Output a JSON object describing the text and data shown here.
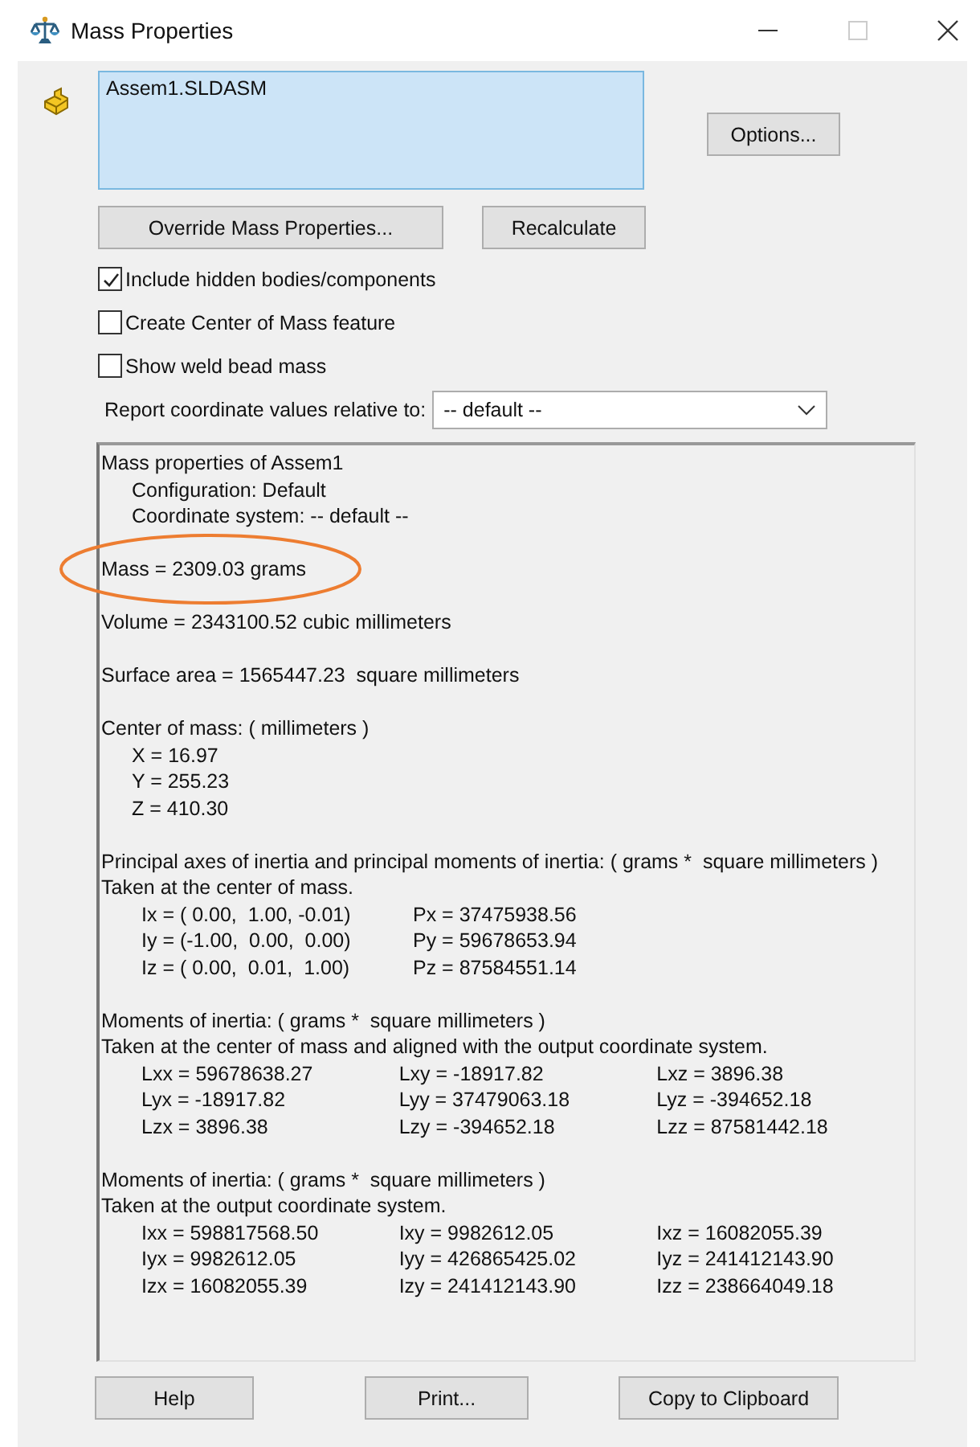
{
  "window": {
    "title": "Mass Properties"
  },
  "selection_list": {
    "items": [
      "Assem1.SLDASM"
    ]
  },
  "buttons_top": [
    {
      "label": "Options..."
    }
  ],
  "buttons_mid": [
    {
      "label": "Override Mass Properties..."
    },
    {
      "label": "Recalculate"
    }
  ],
  "checkboxes": [
    {
      "label": "Include hidden bodies/components",
      "checked": true
    },
    {
      "label": "Create Center of Mass feature",
      "checked": false
    },
    {
      "label": "Show weld bead mass",
      "checked": false
    }
  ],
  "coordinate_select": {
    "label": "Report coordinate values relative to:",
    "value": "-- default --"
  },
  "report": {
    "lines": [
      {
        "kind": "text",
        "text": "Mass properties of Assem1"
      },
      {
        "kind": "indent",
        "text": "Configuration: Default"
      },
      {
        "kind": "indent",
        "text": "Coordinate system: -- default --"
      },
      {
        "kind": "gap"
      },
      {
        "kind": "text",
        "text": "Mass = 2309.03 grams",
        "highlighted": true
      },
      {
        "kind": "gap"
      },
      {
        "kind": "text",
        "text": "Volume = 2343100.52 cubic millimeters"
      },
      {
        "kind": "gap"
      },
      {
        "kind": "text",
        "text": "Surface area = 1565447.23  square millimeters"
      },
      {
        "kind": "gap"
      },
      {
        "kind": "text",
        "text": "Center of mass: ( millimeters )"
      },
      {
        "kind": "indent",
        "text": "X = 16.97"
      },
      {
        "kind": "indent",
        "text": "Y = 255.23"
      },
      {
        "kind": "indent",
        "text": "Z = 410.30"
      },
      {
        "kind": "gap"
      },
      {
        "kind": "text",
        "text": "Principal axes of inertia and principal moments of inertia: ( grams *  square millimeters )"
      },
      {
        "kind": "text",
        "text": "Taken at the center of mass."
      },
      {
        "kind": "row",
        "cells": [
          "Ix = ( 0.00,  1.00, -0.01)",
          "Px = 37475938.56"
        ]
      },
      {
        "kind": "row",
        "cells": [
          "Iy = (-1.00,  0.00,  0.00)",
          "Py = 59678653.94"
        ]
      },
      {
        "kind": "row",
        "cells": [
          "Iz = ( 0.00,  0.01,  1.00)",
          "Pz = 87584551.14"
        ]
      },
      {
        "kind": "gap"
      },
      {
        "kind": "text",
        "text": "Moments of inertia: ( grams *  square millimeters )"
      },
      {
        "kind": "text",
        "text": "Taken at the center of mass and aligned with the output coordinate system."
      },
      {
        "kind": "row",
        "cells": [
          "Lxx = 59678638.27",
          "Lxy = -18917.82",
          "Lxz = 3896.38"
        ]
      },
      {
        "kind": "row",
        "cells": [
          "Lyx = -18917.82",
          "Lyy = 37479063.18",
          "Lyz = -394652.18"
        ]
      },
      {
        "kind": "row",
        "cells": [
          "Lzx = 3896.38",
          "Lzy = -394652.18",
          "Lzz = 87581442.18"
        ]
      },
      {
        "kind": "gap"
      },
      {
        "kind": "text",
        "text": "Moments of inertia: ( grams *  square millimeters )"
      },
      {
        "kind": "text",
        "text": "Taken at the output coordinate system."
      },
      {
        "kind": "row",
        "cells": [
          "Ixx = 598817568.50",
          "Ixy = 9982612.05",
          "Ixz = 16082055.39"
        ]
      },
      {
        "kind": "row",
        "cells": [
          "Iyx = 9982612.05",
          "Iyy = 426865425.02",
          "Iyz = 241412143.90"
        ]
      },
      {
        "kind": "row",
        "cells": [
          "Izx = 16082055.39",
          "Izy = 241412143.90",
          "Izz = 238664049.18"
        ]
      }
    ]
  },
  "buttons_bottom": [
    {
      "label": "Help"
    },
    {
      "label": "Print..."
    },
    {
      "label": "Copy to Clipboard"
    }
  ]
}
